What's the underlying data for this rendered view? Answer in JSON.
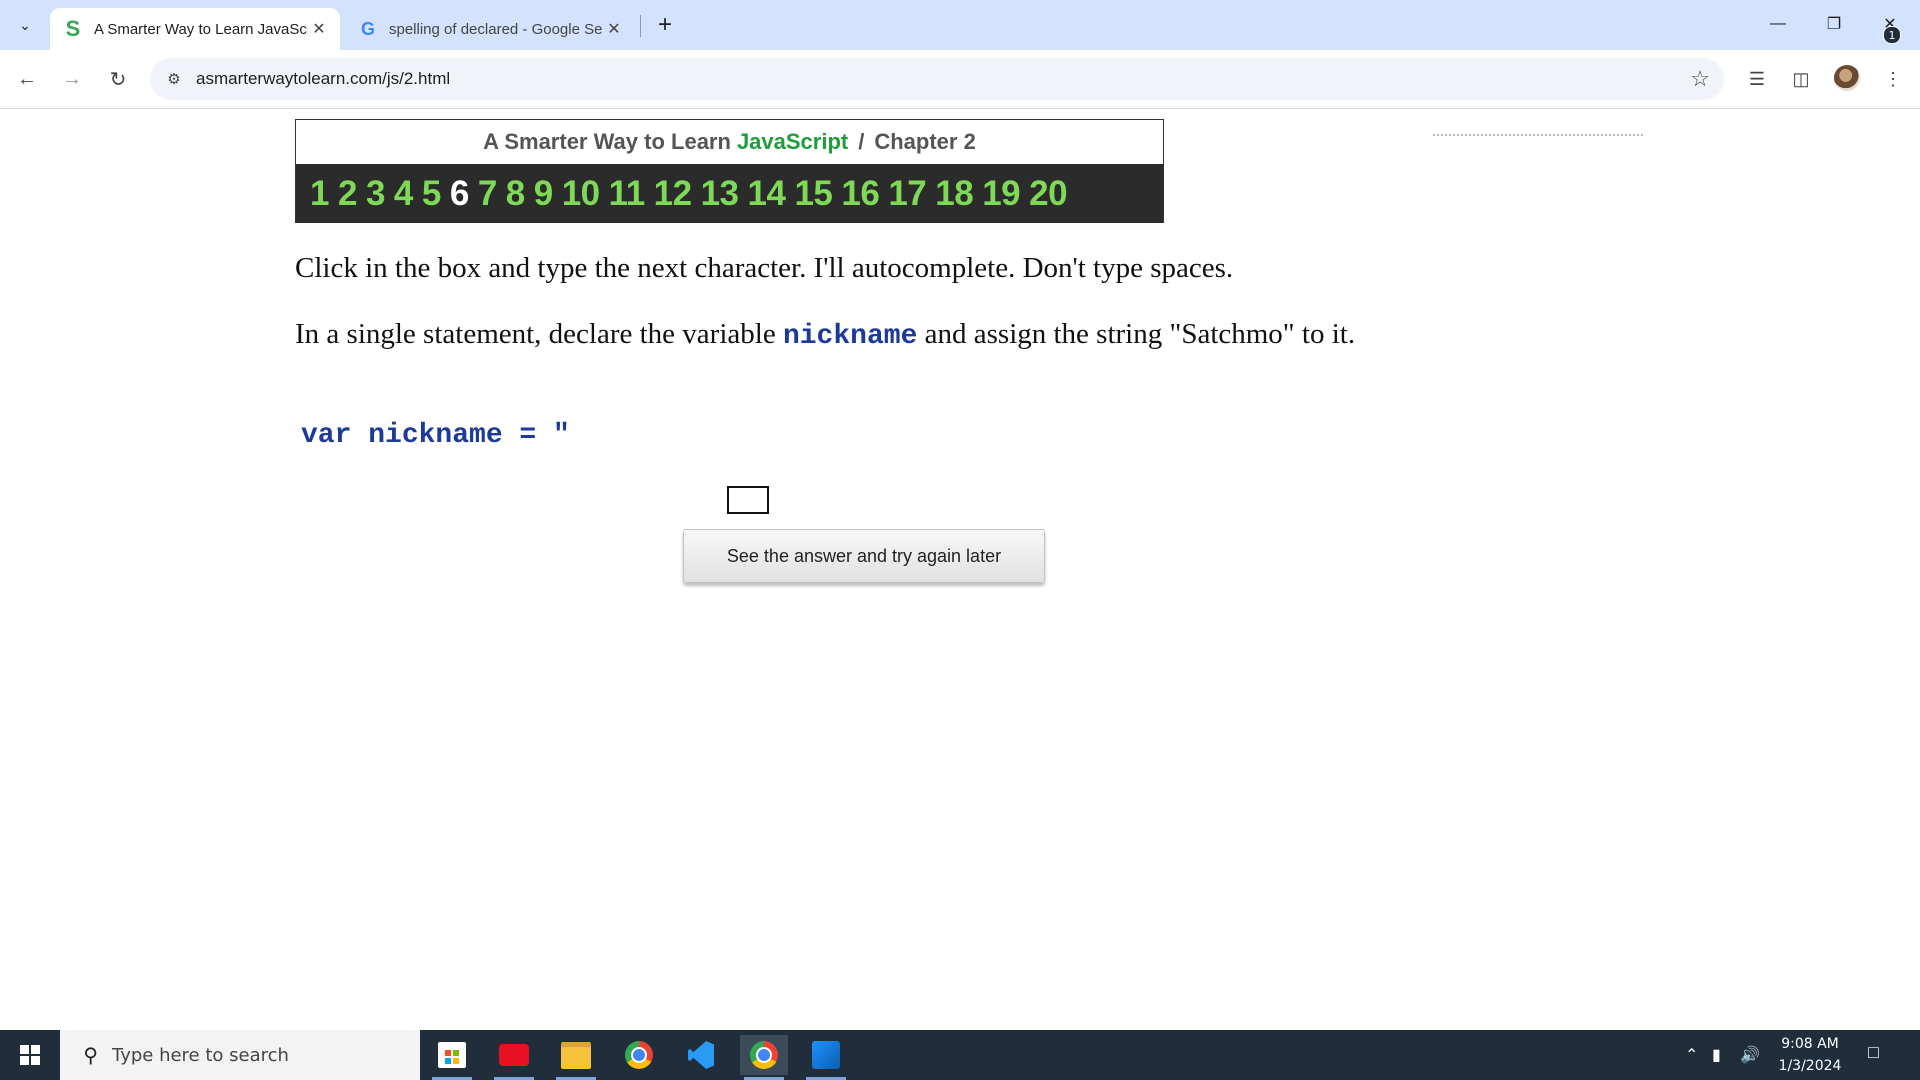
{
  "browser": {
    "tabs": [
      {
        "title": "A Smarter Way to Learn JavaScr",
        "favicon": "s-favicon-icon",
        "active": true
      },
      {
        "title": "spelling of declared - Google Se",
        "favicon": "google-favicon-icon",
        "active": false
      }
    ],
    "url": "asmarterwaytolearn.com/js/2.html"
  },
  "page": {
    "header": {
      "prefix": "A Smarter Way to Learn",
      "brand": "JavaScript",
      "separator": "/",
      "chapter": "Chapter 2"
    },
    "chapters": [
      {
        "label": "1"
      },
      {
        "label": "2"
      },
      {
        "label": "3"
      },
      {
        "label": "4"
      },
      {
        "label": "5"
      },
      {
        "label": "6",
        "current": true
      },
      {
        "label": "7"
      },
      {
        "label": "8"
      },
      {
        "label": "9"
      },
      {
        "label": "10"
      },
      {
        "label": "11"
      },
      {
        "label": "12"
      },
      {
        "label": "13"
      },
      {
        "label": "14"
      },
      {
        "label": "15"
      },
      {
        "label": "16"
      },
      {
        "label": "17"
      },
      {
        "label": "18"
      },
      {
        "label": "19"
      },
      {
        "label": "20"
      }
    ],
    "instruction": "Click in the box and type the next character. I'll autocomplete. Don't type spaces.",
    "prompt": {
      "before": "In a single statement, declare the variable ",
      "variable": "nickname",
      "after": " and assign the string \"Satchmo\" to it."
    },
    "code_so_far": "var nickname = \"",
    "answer_input_value": "",
    "answer_button_label": "See the answer and try again later"
  },
  "taskbar": {
    "search_placeholder": "Type here to search",
    "time": "9:08 AM",
    "date": "1/3/2024",
    "notification_count": "1"
  },
  "colors": {
    "brand_green": "#1e9e3a",
    "chapter_green": "#7ed957",
    "code_blue": "#1c3a99",
    "chapter_bar_bg": "#2b2b2b",
    "tabstrip_bg": "#d3e3fd",
    "taskbar_bg": "#202e3b"
  }
}
